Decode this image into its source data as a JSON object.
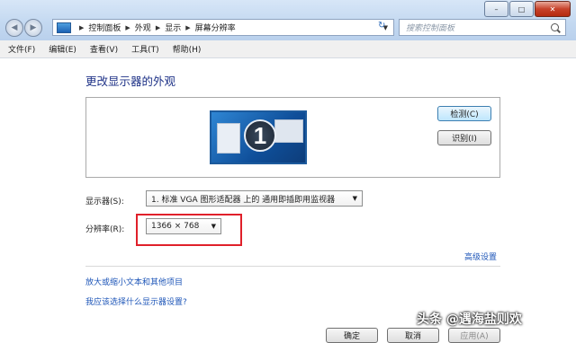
{
  "window": {
    "controls": {
      "minimize": "–",
      "maximize": "□",
      "close": "✕"
    }
  },
  "address_bar": {
    "breadcrumbs": [
      "控制面板",
      "外观",
      "显示",
      "屏幕分辨率"
    ]
  },
  "search": {
    "placeholder": "搜索控制面板"
  },
  "menu": [
    "文件(F)",
    "编辑(E)",
    "查看(V)",
    "工具(T)",
    "帮助(H)"
  ],
  "main": {
    "title": "更改显示器的外观",
    "monitor_number": "1",
    "detect_button": "检测(C)",
    "identify_button": "识别(I)",
    "display_label": "显示器(S):",
    "display_value": "1. 标准 VGA 图形适配器 上的 通用即插即用监视器",
    "resolution_label": "分辨率(R):",
    "resolution_value": "1366 × 768",
    "advanced_link": "高级设置",
    "link_zoom": "放大或缩小文本和其他项目",
    "link_help": "我应该选择什么显示器设置?"
  },
  "footer": {
    "ok": "确定",
    "cancel": "取消",
    "apply": "应用(A)"
  },
  "watermark": "头条 @遇海盐则欢",
  "colors": {
    "accent_title": "#1e3287",
    "link": "#1e56b8",
    "highlight_box": "#e0202a"
  }
}
